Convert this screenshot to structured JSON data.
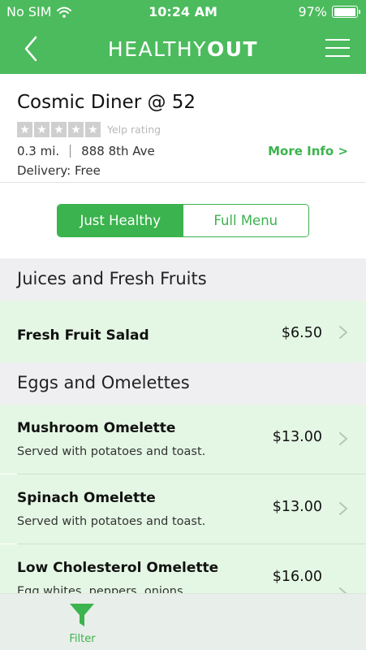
{
  "status_bar": {
    "carrier": "No SIM",
    "time": "10:24 AM",
    "battery": "97%",
    "battery_level": 0.97,
    "wifi_icon": "wifi-icon"
  },
  "nav": {
    "logo_light": "HEALTHY",
    "logo_bold": "OUT",
    "back_icon": "chevron-left-icon",
    "menu_icon": "hamburger-menu-icon"
  },
  "restaurant": {
    "name": "Cosmic Diner @ 52",
    "rating_label": "Yelp rating",
    "rating_stars": 0,
    "distance": "0.3 mi.",
    "address": "888 8th Ave",
    "delivery": "Delivery: Free",
    "more_info": "More Info >"
  },
  "toggle": {
    "left": "Just Healthy",
    "right": "Full Menu",
    "selected": "Just Healthy"
  },
  "sections": [
    {
      "title": "Juices and Fresh Fruits",
      "items": [
        {
          "name": "Fresh Fruit Salad",
          "description": "",
          "price": "$6.50"
        }
      ]
    },
    {
      "title": "Eggs and Omelettes",
      "items": [
        {
          "name": "Mushroom Omelette",
          "description": "Served with potatoes and toast.",
          "price": "$13.00"
        },
        {
          "name": "Spinach Omelette",
          "description": "Served with potatoes and toast.",
          "price": "$13.00"
        },
        {
          "name": "Low Cholesterol Omelette",
          "description": "Egg whites, peppers, onions",
          "price": "$16.00"
        }
      ]
    }
  ],
  "tabbar": {
    "filter_label": "Filter",
    "filter_icon": "funnel-icon"
  },
  "colors": {
    "brand_green": "#4cbb5d",
    "accent_green": "#3bb34e",
    "item_bg": "#e4f7e4",
    "section_bg": "#efeff1"
  }
}
